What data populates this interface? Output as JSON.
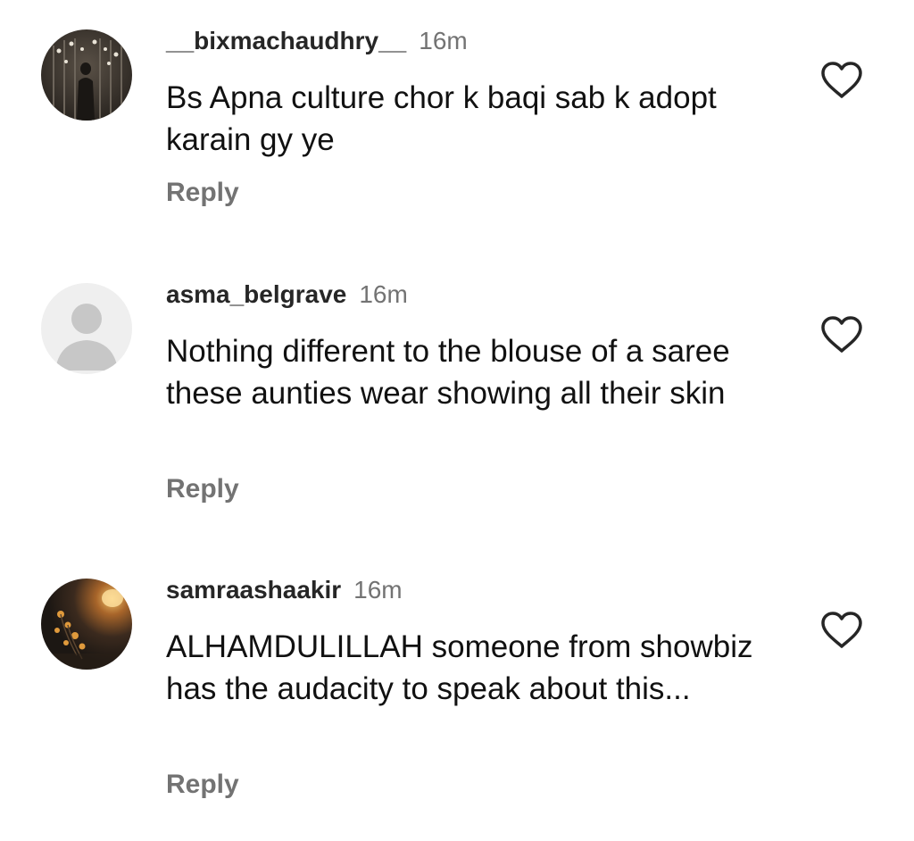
{
  "comments": [
    {
      "username": "__bixmachaudhry__",
      "time": "16m",
      "text": "Bs Apna culture chor k baqi sab k adopt karain gy ye",
      "reply_label": "Reply",
      "avatar_icon": "photo-avatar-dark",
      "like_icon": "heart-outline-icon"
    },
    {
      "username": "asma_belgrave",
      "time": "16m",
      "text": "Nothing different to the blouse of a saree these aunties wear showing all their skin",
      "reply_label": "Reply",
      "avatar_icon": "default-person-avatar",
      "like_icon": "heart-outline-icon"
    },
    {
      "username": "samraashaakir",
      "time": "16m",
      "text": "ALHAMDULILLAH someone from showbiz has the audacity to speak about this...",
      "reply_label": "Reply",
      "avatar_icon": "photo-avatar-flowers",
      "like_icon": "heart-outline-icon"
    }
  ]
}
